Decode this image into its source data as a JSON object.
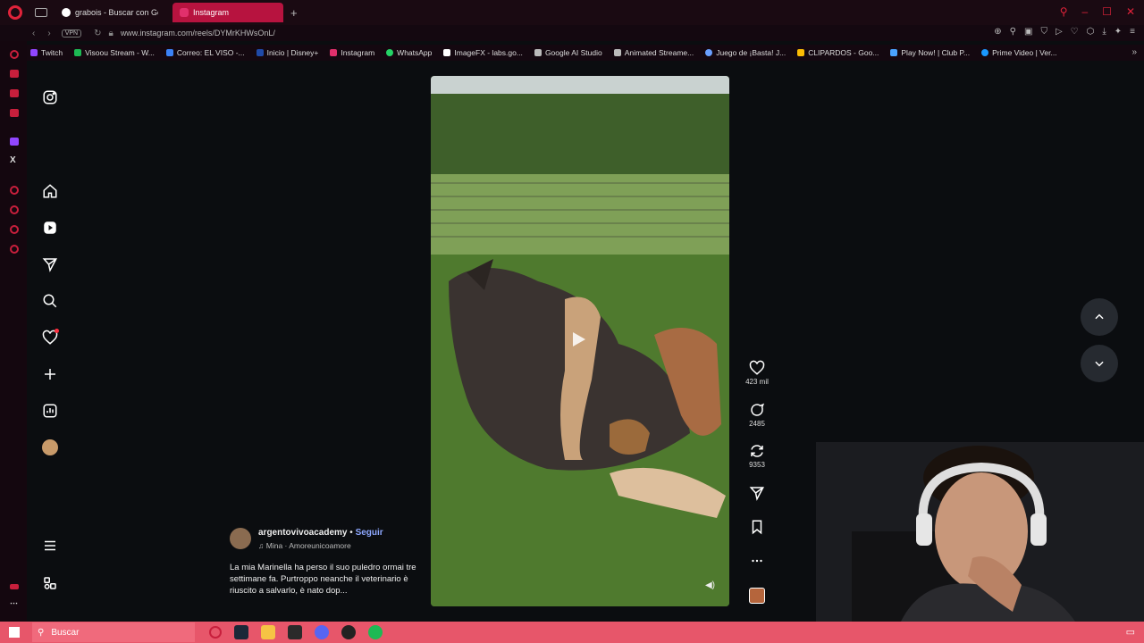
{
  "browser": {
    "tabs": [
      {
        "label": "grabois - Buscar con Goog",
        "active": false
      },
      {
        "label": "Instagram",
        "active": true
      }
    ],
    "new_tab": "+",
    "url": "www.instagram.com/reels/DYMrKHWsOnL/",
    "vpn": "VPN",
    "bookmarks": [
      {
        "label": "Twitch",
        "color": "#9146ff"
      },
      {
        "label": "Visoou Stream - W...",
        "color": "#1db954"
      },
      {
        "label": "Correo: EL VISO -...",
        "color": "#3b82f6"
      },
      {
        "label": "Inicio | Disney+",
        "color": "#1f4aa8"
      },
      {
        "label": "Instagram",
        "color": "#e1306c"
      },
      {
        "label": "WhatsApp",
        "color": "#25d366"
      },
      {
        "label": "ImageFX - labs.go...",
        "color": "#ffffff"
      },
      {
        "label": "Google AI Studio",
        "color": "#bbbbbb"
      },
      {
        "label": "Animated Streame...",
        "color": "#bbbbbb"
      },
      {
        "label": "Juego de ¡Basta! J...",
        "color": "#6aa0ff"
      },
      {
        "label": "CLIPARDOS - Goo...",
        "color": "#fbbc04"
      },
      {
        "label": "Play Now! | Club P...",
        "color": "#4aa3ff"
      },
      {
        "label": "Prime Video | Ver...",
        "color": "#1a98ff"
      }
    ]
  },
  "reel": {
    "likes": "423 mil",
    "comments": "2485",
    "reposts": "9353",
    "username": "argentovivoacademy",
    "separator": "•",
    "follow": "Seguir",
    "audio": "Mina · Amoreunicoamore",
    "caption": "La mia Marinella ha perso il suo puledro ormai tre settimane fa. Purtroppo neanche il veterinario è riuscito a salvarlo, è nato dop..."
  },
  "taskbar": {
    "search_placeholder": "Buscar"
  },
  "colors": {
    "accent": "#b7133f",
    "taskbar": "#e7566a",
    "follow": "#8ea8ff"
  }
}
